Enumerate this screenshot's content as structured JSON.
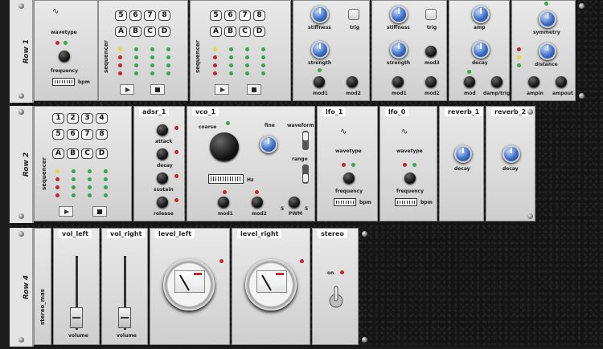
{
  "rows": [
    {
      "label": "Row 1"
    },
    {
      "label": "Row 2"
    },
    {
      "label": "Row 4"
    }
  ],
  "row1": {
    "sequencer_label": "sequencer",
    "keys": [
      "5",
      "6",
      "7",
      "8",
      "A",
      "B",
      "C",
      "D"
    ],
    "waveform_label": "wavetype",
    "frequency_label": "frequency",
    "bpm_label": "bpm",
    "drum1": {
      "stiffness": "stiffness",
      "trig": "trig",
      "strength": "strength",
      "mod1": "mod1",
      "mod2": "mod2"
    },
    "drum2": {
      "stiffness": "stiffness",
      "trig": "trig",
      "strength": "strength",
      "mod1": "mod1",
      "mod2": "mod2",
      "mod3": "mod3"
    },
    "env": {
      "amp": "amp",
      "decay": "decay",
      "mod": "mod",
      "damp": "damp/trig"
    },
    "out": {
      "symmetry": "symmetry",
      "distance": "distance",
      "ampin": "ampin",
      "ampout": "ampout"
    }
  },
  "row2": {
    "sequencer_label": "sequencer",
    "keys": [
      "1",
      "2",
      "3",
      "4",
      "5",
      "6",
      "7",
      "8",
      "A",
      "B",
      "C",
      "D"
    ],
    "adsr": {
      "title": "adsr_1",
      "attack": "attack",
      "decay": "decay",
      "sustain": "sustain",
      "release": "release"
    },
    "vco": {
      "title": "vco_1",
      "coarse": "coarse",
      "fine": "fine",
      "waveform": "waveform",
      "range": "range",
      "hz": "Hz",
      "mod1": "mod1",
      "mod2": "mod2",
      "pwm": "PWM",
      "pwm_left": "5",
      "pwm_right": "5"
    },
    "lfo1": {
      "title": "lfo_1",
      "wavetype": "wavetype",
      "frequency": "frequency",
      "bpm": "bpm"
    },
    "lfo2": {
      "title": "lfo_0",
      "wavetype": "wavetype",
      "frequency": "frequency",
      "bpm": "bpm"
    },
    "reverb1": {
      "title": "reverb_1",
      "decay": "decay"
    },
    "reverb2": {
      "title": "reverb_2",
      "decay": "decay"
    }
  },
  "row4": {
    "mixer_label": "stereo_mas",
    "vol_left": {
      "title": "vol_left",
      "label": "volume"
    },
    "vol_right": {
      "title": "vol_right",
      "label": "volume"
    },
    "level_left": {
      "title": "level_left"
    },
    "level_right": {
      "title": "level_right"
    },
    "stereo": {
      "title": "stereo",
      "on": "on"
    }
  },
  "colors": {
    "blue_knob": "#3b6fc7",
    "led_red": "#c3262b",
    "led_green": "#34a84a",
    "led_yellow": "#e8d534"
  }
}
